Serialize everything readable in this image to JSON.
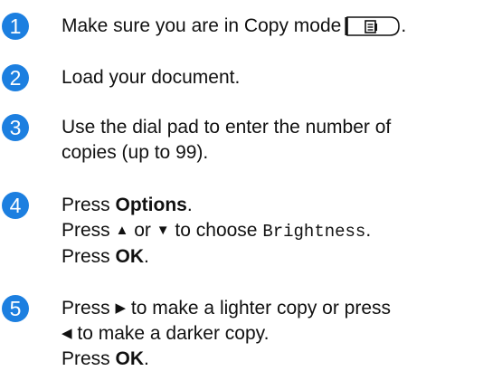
{
  "accent_color": "#1c7fe0",
  "steps": [
    {
      "number": "1",
      "text": "Make sure you are in Copy mode",
      "end": ".",
      "icon": "copy-mode-key-icon"
    },
    {
      "number": "2",
      "text": "Load your document."
    },
    {
      "number": "3",
      "line1": "Use the dial pad to enter the number of",
      "line2": "copies (up to 99)."
    },
    {
      "number": "4",
      "line1_prefix": "Press ",
      "line1_bold": "Options",
      "line1_suffix": ".",
      "line2_press": "Press ",
      "line2_up": "▲",
      "line2_or": " or ",
      "line2_down": "▼",
      "line2_choose": " to choose ",
      "line2_mono": "Brightness",
      "line2_end": ".",
      "line3_prefix": "Press ",
      "line3_bold": "OK",
      "line3_end": "."
    },
    {
      "number": "5",
      "line1_press": "Press ",
      "line1_right": "▶",
      "line1_rest": " to make a lighter copy or press",
      "line2_left": "◀",
      "line2_rest": " to make a darker copy.",
      "line3_prefix": "Press ",
      "line3_bold": "OK",
      "line3_end": "."
    }
  ]
}
